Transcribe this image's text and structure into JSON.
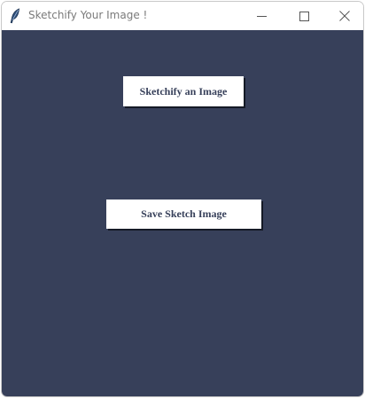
{
  "window": {
    "title": "Sketchify Your Image !",
    "app_icon": "feather-icon",
    "controls": {
      "minimize_icon": "minimize-icon",
      "maximize_icon": "maximize-icon",
      "close_icon": "close-icon"
    }
  },
  "main": {
    "background_color": "#37405a",
    "sketchify_label": "Sketchify an Image",
    "save_label": "Save Sketch Image"
  }
}
